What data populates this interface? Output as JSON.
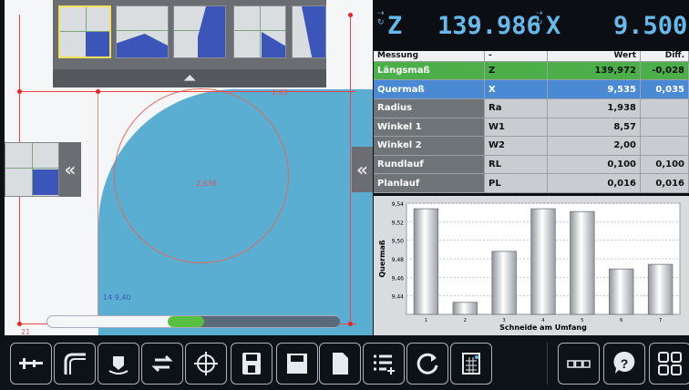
{
  "viewport": {
    "label_top": "1,93",
    "label_center": "2,636",
    "label_lower": "14 9,40",
    "label_corner": "21",
    "progress_value_fraction": 0.47
  },
  "dro": {
    "z_axis": "Z",
    "z_value": "139.986",
    "x_axis": "X",
    "x_value": "9.500"
  },
  "table": {
    "headers": [
      "Messung",
      "-",
      "Wert",
      "Diff."
    ],
    "rows": [
      {
        "name": "Längsmaß",
        "sym": "Z",
        "value": "139,972",
        "diff": "-0,028"
      },
      {
        "name": "Quermaß",
        "sym": "X",
        "value": "9,535",
        "diff": "0,035"
      },
      {
        "name": "Radius",
        "sym": "Ra",
        "value": "1,938",
        "diff": ""
      },
      {
        "name": "Winkel 1",
        "sym": "W1",
        "value": "8,57",
        "diff": ""
      },
      {
        "name": "Winkel 2",
        "sym": "W2",
        "value": "2,00",
        "diff": ""
      },
      {
        "name": "Rundlauf",
        "sym": "RL",
        "value": "0,100",
        "diff": "0,100"
      },
      {
        "name": "Planlauf",
        "sym": "PL",
        "value": "0,016",
        "diff": "0,016"
      }
    ]
  },
  "chart_data": {
    "type": "bar",
    "categories": [
      "1",
      "2",
      "3",
      "4",
      "5",
      "6",
      "7"
    ],
    "values": [
      9.534,
      9.433,
      9.488,
      9.534,
      9.531,
      9.469,
      9.474
    ],
    "xlabel": "Schneide am Umfang",
    "ylabel": "Quermaß",
    "ylim": [
      9.42,
      9.54
    ],
    "yticks": [
      "9,54",
      "9,52",
      "9,50",
      "9,48",
      "9,46",
      "9,44"
    ],
    "grid": true
  },
  "toolbar": {
    "buttons": [
      "caliper-icon",
      "radius-gauge-icon",
      "rotate-part-icon",
      "swap-icon",
      "crosshair-icon",
      "save-icon",
      "disk-icon",
      "document-icon",
      "list-add-icon",
      "refresh-icon",
      "calculator-icon",
      "dots-icon",
      "help-icon",
      "grid-icon"
    ]
  },
  "colors": {
    "accent_blue": "#66b9ea",
    "row_green": "#4caf4a",
    "row_blue": "#4a8ad4",
    "shape_blue": "#5aaed2",
    "progress_green": "#58c040"
  }
}
